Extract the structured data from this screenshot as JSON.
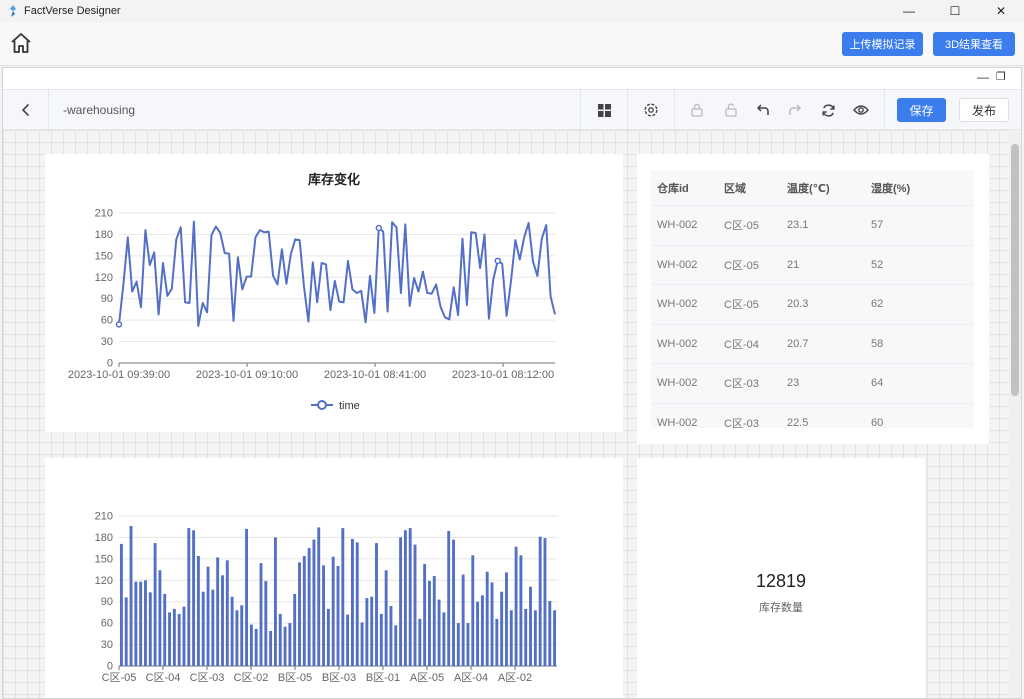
{
  "app": {
    "title": "FactVerse Designer",
    "accent": "#3b7ded"
  },
  "topbar": {
    "upload_label": "上传模拟记录",
    "view3d_label": "3D结果查看",
    "home_icon": "home-icon"
  },
  "editor": {
    "doc_name": "-warehousing",
    "save_label": "保存",
    "publish_label": "发布",
    "toolbar_icons": [
      "layout-icon",
      "settings-icon",
      "lock-icon",
      "unlock-icon",
      "undo-icon",
      "redo-icon",
      "refresh-icon",
      "preview-icon"
    ]
  },
  "chart_data": [
    {
      "type": "line",
      "title": "库存变化",
      "series": [
        {
          "name": "time",
          "color": "#5470c6",
          "values": [
            54,
            110,
            176,
            100,
            114,
            78,
            186,
            137,
            155,
            68,
            140,
            94,
            104,
            173,
            190,
            85,
            84,
            198,
            52,
            84,
            71,
            179,
            191,
            182,
            154,
            153,
            59,
            148,
            103,
            121,
            121,
            176,
            186,
            183,
            184,
            122,
            110,
            159,
            111,
            152,
            173,
            172,
            107,
            58,
            141,
            85,
            140,
            138,
            74,
            115,
            86,
            85,
            143,
            103,
            98,
            101,
            57,
            122,
            70,
            189,
            184,
            72,
            197,
            190,
            98,
            194,
            80,
            119,
            100,
            128,
            98,
            97,
            110,
            79,
            64,
            61,
            106,
            67,
            174,
            81,
            183,
            182,
            133,
            180,
            62,
            117,
            143,
            139,
            66,
            115,
            172,
            145,
            176,
            196,
            142,
            122,
            174,
            193,
            93,
            68
          ]
        }
      ],
      "x_tick_labels": [
        "2023-10-01 09:39:00",
        "2023-10-01 09:10:00",
        "2023-10-01 08:41:00",
        "2023-10-01 08:12:00"
      ],
      "ylim": [
        0,
        210
      ],
      "y_ticks": [
        0,
        30,
        60,
        90,
        120,
        150,
        180,
        210
      ],
      "legend": "bottom-center",
      "grid": true
    },
    {
      "type": "bar",
      "title": "",
      "series": [
        {
          "name": "",
          "color": "#5470c6",
          "values": [
            171,
            96,
            196,
            118,
            118,
            120,
            103,
            172,
            134,
            101,
            75,
            80,
            73,
            83,
            193,
            190,
            154,
            104,
            139,
            107,
            152,
            127,
            148,
            97,
            78,
            85,
            192,
            58,
            52,
            144,
            119,
            49,
            180,
            73,
            55,
            60,
            101,
            145,
            154,
            165,
            177,
            194,
            141,
            80,
            153,
            140,
            193,
            72,
            178,
            173,
            61,
            95,
            97,
            172,
            73,
            134,
            84,
            57,
            180,
            190,
            193,
            170,
            66,
            143,
            119,
            126,
            93,
            75,
            189,
            177,
            60,
            128,
            60,
            155,
            90,
            99,
            132,
            117,
            66,
            104,
            131,
            78,
            167,
            155,
            80,
            111,
            78,
            181,
            179,
            91,
            78
          ]
        }
      ],
      "x_tick_labels": [
        "C区-05",
        "C区-04",
        "C区-03",
        "C区-02",
        "B区-05",
        "B区-03",
        "B区-01",
        "A区-05",
        "A区-04",
        "A区-02"
      ],
      "ylim": [
        0,
        210
      ],
      "y_ticks": [
        0,
        30,
        60,
        90,
        120,
        150,
        180,
        210
      ],
      "grid": true
    }
  ],
  "table": {
    "columns": [
      "仓库id",
      "区域",
      "温度(℃)",
      "湿度(%)"
    ],
    "rows": [
      [
        "WH-002",
        "C区-05",
        "23.1",
        "57"
      ],
      [
        "WH-002",
        "C区-05",
        "21",
        "52"
      ],
      [
        "WH-002",
        "C区-05",
        "20.3",
        "62"
      ],
      [
        "WH-002",
        "C区-04",
        "20.7",
        "58"
      ],
      [
        "WH-002",
        "C区-03",
        "23",
        "64"
      ],
      [
        "WH-002",
        "C区-03",
        "22.5",
        "60"
      ]
    ]
  },
  "kpi": {
    "value": "12819",
    "label": "库存数量"
  }
}
